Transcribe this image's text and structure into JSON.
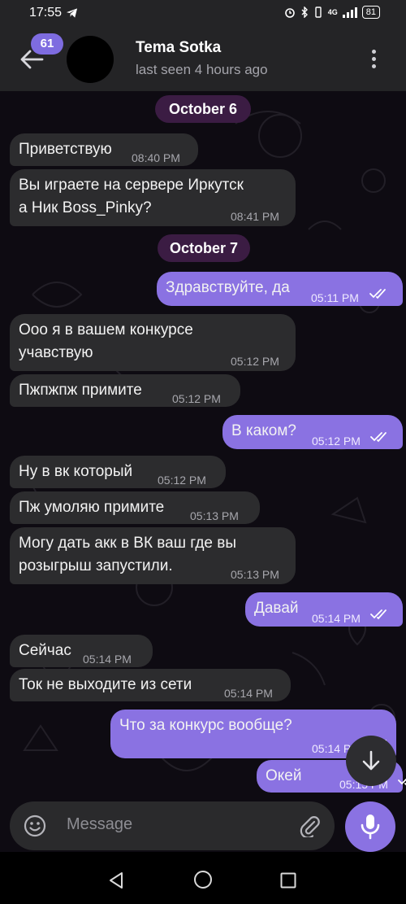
{
  "status_bar": {
    "time": "17:55",
    "network": "4G",
    "battery": "81"
  },
  "header": {
    "unread_count": "61",
    "contact_name": "Tema Sotka",
    "last_seen": "last seen 4 hours ago"
  },
  "messages": [
    {
      "type": "date",
      "text": "October 6"
    },
    {
      "type": "in",
      "text": "Приветствую",
      "time": "08:40 PM"
    },
    {
      "type": "in",
      "text": "Вы играете на сервере Иркутск\nа Ник Boss_Pinky?",
      "time": "08:41 PM"
    },
    {
      "type": "date",
      "text": "October 7"
    },
    {
      "type": "out",
      "text": "Здравствуйте, да",
      "time": "05:11 PM",
      "read": true
    },
    {
      "type": "in",
      "text": "Ооо я в вашем конкурсе\nучавствую",
      "time": "05:12 PM"
    },
    {
      "type": "in",
      "text": "Пжпжпж примите",
      "time": "05:12 PM"
    },
    {
      "type": "out",
      "text": "В каком?",
      "time": "05:12 PM",
      "read": true
    },
    {
      "type": "in",
      "text": "Ну в вк который",
      "time": "05:12 PM"
    },
    {
      "type": "in",
      "text": "Пж умоляю примите",
      "time": "05:13 PM"
    },
    {
      "type": "in",
      "text": "Могу дать акк в ВК ваш где вы\nрозыгрыш запустили.",
      "time": "05:13 PM"
    },
    {
      "type": "out",
      "text": "Давай",
      "time": "05:14 PM",
      "read": true
    },
    {
      "type": "in",
      "text": "Сейчас",
      "time": "05:14 PM"
    },
    {
      "type": "in",
      "text": "Ток не выходите из сети",
      "time": "05:14 PM"
    },
    {
      "type": "out",
      "text": "Что за конкурс вообще?",
      "time": "05:14 PM",
      "read": true
    },
    {
      "type": "out",
      "text": "Окей",
      "time": "05:15 PM",
      "read": true
    }
  ],
  "composer": {
    "placeholder": "Message"
  },
  "icons": {
    "back": "arrow-left-icon",
    "menu": "more-vertical-icon",
    "scroll_down": "chevron-down-icon",
    "emoji": "smiley-icon",
    "attach": "paperclip-icon",
    "mic": "microphone-icon",
    "read_status": "double-check-icon"
  },
  "colors": {
    "accent": "#8a72e2",
    "incoming_bubble": "#2c2c2e",
    "date_pill": "#3b1c43",
    "background": "#0e0b12"
  }
}
